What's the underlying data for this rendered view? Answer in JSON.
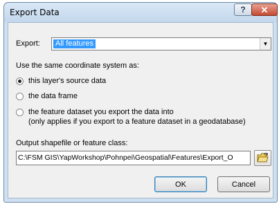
{
  "window": {
    "title": "Export Data",
    "help_glyph": "?",
    "close_glyph": "✕"
  },
  "export": {
    "label": "Export:",
    "selected": "All features"
  },
  "coordinate_system": {
    "label": "Use the same coordinate system as:",
    "options": [
      {
        "label": "this layer's source data",
        "selected": true
      },
      {
        "label": "the data frame",
        "selected": false
      },
      {
        "label": "the feature dataset you export the data into",
        "note": "(only applies if you export to a feature dataset in a geodatabase)",
        "selected": false
      }
    ]
  },
  "output": {
    "label": "Output shapefile or feature class:",
    "value": "C:\\FSM GIS\\YapWorkshop\\Pohnpei\\Geospatial\\Features\\Export_O"
  },
  "buttons": {
    "ok": "OK",
    "cancel": "Cancel"
  },
  "icons": {
    "browse": "open-folder-icon"
  }
}
